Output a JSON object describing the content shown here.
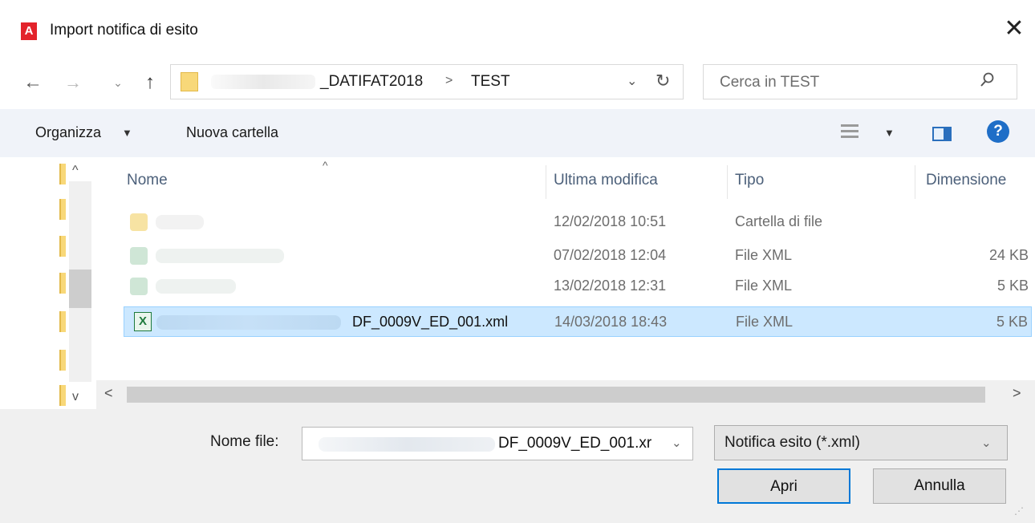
{
  "window": {
    "title": "Import notifica di esito",
    "app_icon_letter": "A",
    "close_glyph": "✕"
  },
  "nav": {
    "back": "←",
    "forward": "→",
    "recent": "⌄",
    "up": "↑",
    "breadcrumb": [
      "_DATIFAT2018",
      "TEST"
    ],
    "breadcrumb_separator": ">",
    "dropdown": "⌄",
    "refresh": "↻"
  },
  "search": {
    "placeholder": "Cerca in TEST",
    "icon": "search-icon"
  },
  "toolbar": {
    "organize": "Organizza",
    "organize_arrow": "▼",
    "new_folder": "Nuova cartella",
    "view_arrow": "▼",
    "help": "?"
  },
  "list": {
    "sort_indicator": "^",
    "columns": [
      "Nome",
      "Ultima modifica",
      "Tipo",
      "Dimensione"
    ],
    "rows": [
      {
        "name": "",
        "date": "12/02/2018 10:51",
        "type": "Cartella di file",
        "size": "",
        "icon": "folder-icon",
        "selected": false
      },
      {
        "name": "",
        "date": "07/02/2018 12:04",
        "type": "File XML",
        "size": "24 KB",
        "icon": "xml-file-icon",
        "selected": false
      },
      {
        "name": "",
        "date": "13/02/2018 12:31",
        "type": "File XML",
        "size": "5 KB",
        "icon": "xml-file-icon",
        "selected": false
      },
      {
        "name": "DF_0009V_ED_001.xml",
        "date": "14/03/2018 18:43",
        "type": "File XML",
        "size": "5 KB",
        "icon": "excel-xml-icon",
        "selected": true
      }
    ],
    "xml_icon_letter": "X",
    "nav_up": "^",
    "nav_down": "v",
    "scroll_left": "<",
    "scroll_right": ">"
  },
  "footer": {
    "filename_label": "Nome file:",
    "filename_value": "DF_0009V_ED_001.xr",
    "filename_dropdown": "⌄",
    "filter_value": "Notifica esito (*.xml)",
    "filter_dropdown": "⌄",
    "open_button": "Apri",
    "cancel_button": "Annulla"
  },
  "colors": {
    "selection": "#cce8ff",
    "accent": "#0078d7",
    "toolbar_bg": "#f0f3f9",
    "footer_bg": "#f0f0f0"
  }
}
